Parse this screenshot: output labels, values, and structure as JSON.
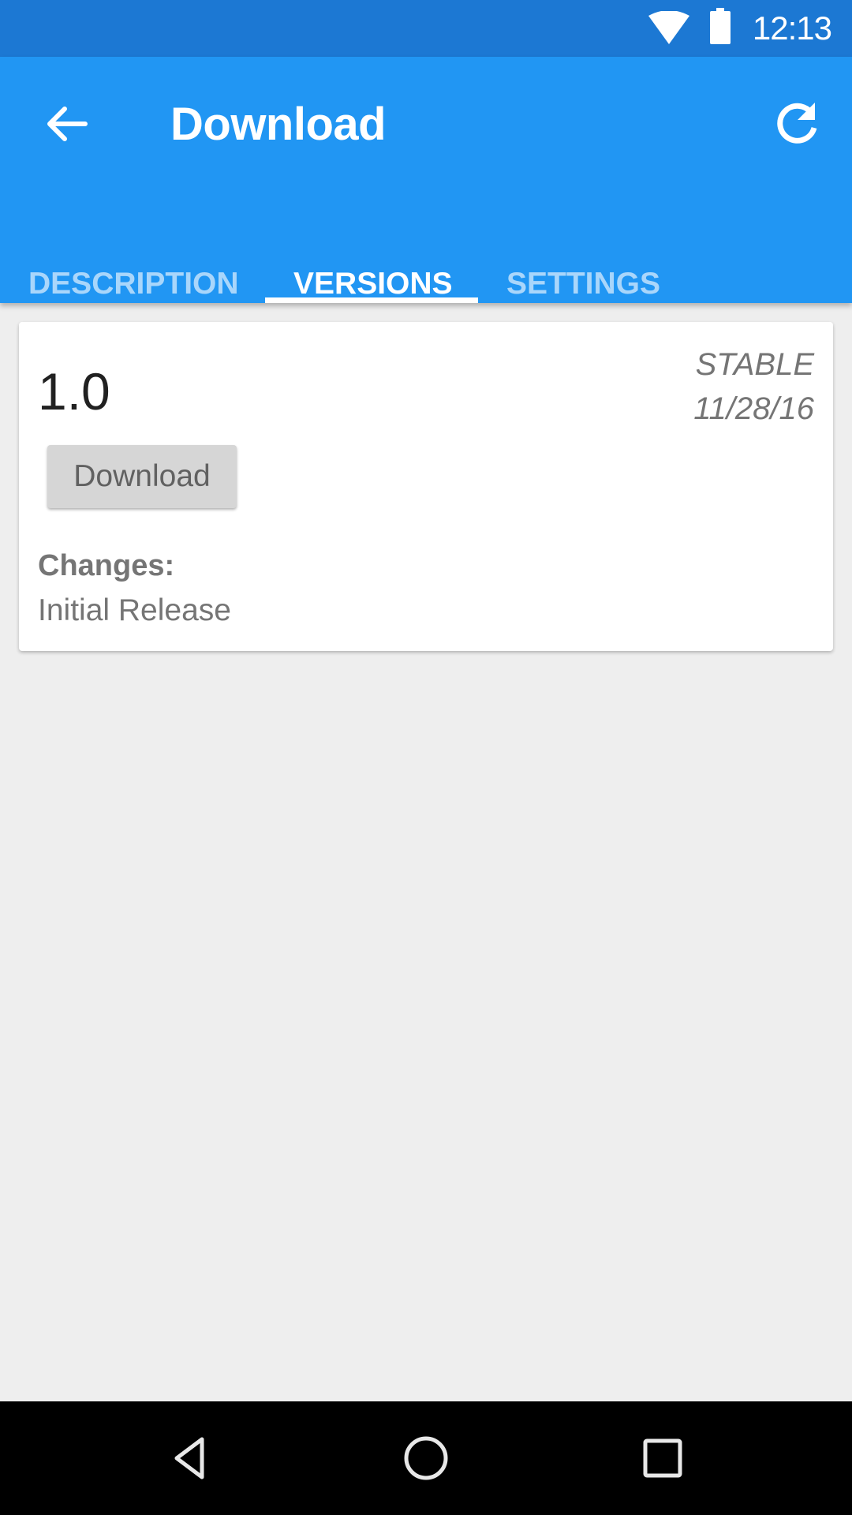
{
  "status_bar": {
    "time": "12:13",
    "icons": [
      "wifi-icon",
      "battery-icon"
    ]
  },
  "app_bar": {
    "title": "Download",
    "back_icon": "arrow-back-icon",
    "refresh_icon": "refresh-icon"
  },
  "tabs": [
    {
      "label": "DESCRIPTION",
      "active": false
    },
    {
      "label": "VERSIONS",
      "active": true
    },
    {
      "label": "SETTINGS",
      "active": false
    }
  ],
  "colors": {
    "primary": "#2196f3",
    "primary_dark": "#1c78d3",
    "background": "#eeeeee"
  },
  "version_card": {
    "version": "1.0",
    "channel": "STABLE",
    "date": "11/28/16",
    "download_label": "Download",
    "changes_label": "Changes:",
    "changes_text": "Initial Release"
  },
  "nav_bar": {
    "icons": [
      "back-icon",
      "home-icon",
      "recents-icon"
    ]
  }
}
